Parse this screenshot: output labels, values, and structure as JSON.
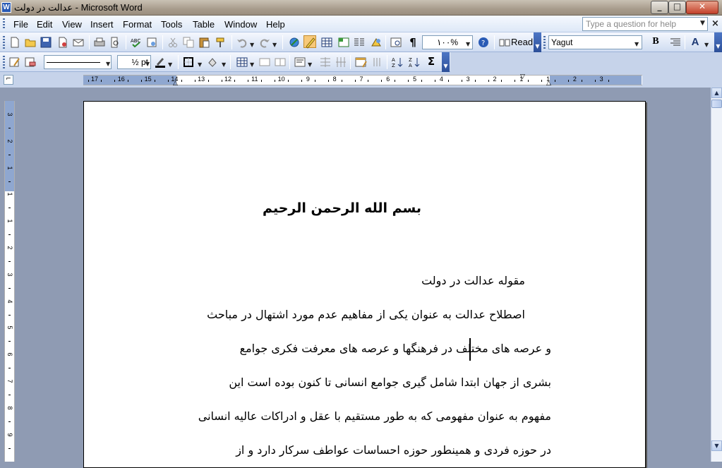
{
  "window": {
    "title": "عدالت در دولت - Microsoft Word",
    "minimize": "_",
    "maximize": "□",
    "close": "✕"
  },
  "menu": {
    "items": [
      "File",
      "Edit",
      "View",
      "Insert",
      "Format",
      "Tools",
      "Table",
      "Window",
      "Help"
    ],
    "help_placeholder": "Type a question for help",
    "close_glyph": "×"
  },
  "toolbar": {
    "zoom": "۱۰۰%",
    "read_label": "Read",
    "font_name": "Yagut",
    "bold": "B",
    "line_weight": "½ pt",
    "autosum": "Σ"
  },
  "ruler": {
    "horizontal_labels": [
      "17",
      "16",
      "15",
      "14",
      "13",
      "12",
      "11",
      "10",
      "9",
      "8",
      "7",
      "6",
      "5",
      "4",
      "3",
      "2",
      "1",
      "1",
      "2",
      "3"
    ],
    "vertical_labels": [
      "3",
      "2",
      "1",
      "1",
      "1",
      "2",
      "3",
      "4",
      "5",
      "6",
      "7",
      "8",
      "9"
    ]
  },
  "document": {
    "heading": "بسم الله الرحمن الرحیم",
    "subtitle": "مقوله عدالت در دولت",
    "lines": [
      "اصطلاح عدالت به عنوان یکی از مفاهیم عدم مورد اشتهال در مباحث",
      "و عرصه های مختلف در فرهنگها و عرصه های معرفت فکری جوامع",
      "بشری از جهان ابتدا شامل گیری جوامع انسانی تا کنون بوده است این",
      "مفهوم به عنوان مفهومی که به طور مستقیم با عقل و ادراکات عالیه انسانی",
      "در حوزه فردی و همینطور حوزه احساسات عواطف سرکار دارد و از"
    ]
  }
}
